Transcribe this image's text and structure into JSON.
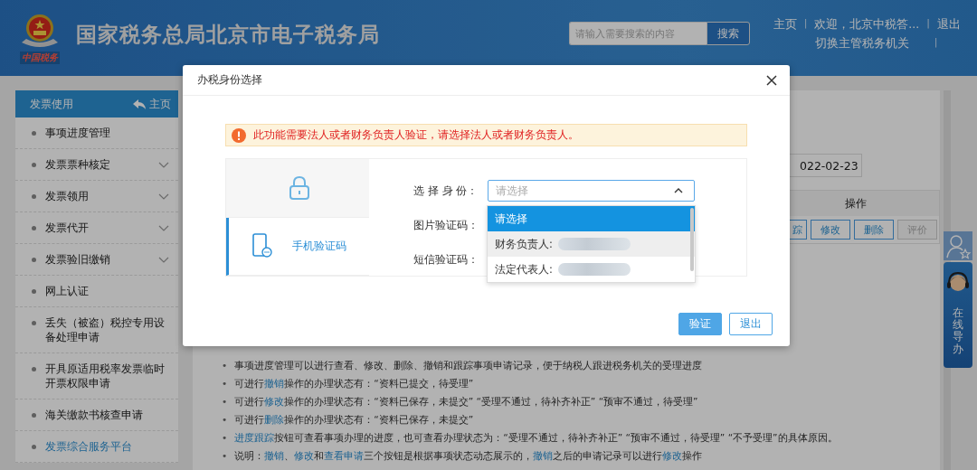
{
  "header": {
    "emblem_caption": "中国税务",
    "title": "国家税务总局北京市电子税务局",
    "search": {
      "placeholder": "请输入需要搜索的内容"
    },
    "search_button": "搜索",
    "nav_line1": [
      {
        "kind": "link",
        "text": "主页"
      },
      {
        "kind": "sep",
        "text": "|"
      },
      {
        "kind": "link",
        "text": "欢迎，北京中税答..."
      },
      {
        "kind": "sep",
        "text": "|"
      },
      {
        "kind": "link",
        "text": "退出"
      }
    ],
    "nav_line2": [
      {
        "kind": "link",
        "text": "切换主管税务机关"
      },
      {
        "kind": "sep",
        "text": "|"
      }
    ]
  },
  "sidebar": {
    "title": "发票使用",
    "home_link": "主页",
    "items": [
      {
        "label": "事项进度管理",
        "expandable": false,
        "selected": false
      },
      {
        "label": "发票票种核定",
        "expandable": true,
        "selected": false
      },
      {
        "label": "发票领用",
        "expandable": true,
        "selected": false
      },
      {
        "label": "发票代开",
        "expandable": true,
        "selected": false
      },
      {
        "label": "发票验旧缴销",
        "expandable": true,
        "selected": false
      },
      {
        "label": "网上认证",
        "expandable": false,
        "selected": false
      },
      {
        "label": "丢失（被盗）税控专用设备处理申请",
        "expandable": false,
        "selected": false
      },
      {
        "label": "开具原适用税率发票临时开票权限申请",
        "expandable": false,
        "selected": false
      },
      {
        "label": "海关缴款书核查申请",
        "expandable": false,
        "selected": false
      },
      {
        "label": "发票综合服务平台",
        "expandable": false,
        "selected": true
      }
    ]
  },
  "main": {
    "date_value": "022-02-23",
    "table": {
      "column": "操作",
      "row_buttons": [
        {
          "label": "踪",
          "disabled": false
        },
        {
          "label": "修改",
          "disabled": false
        },
        {
          "label": "删除",
          "disabled": false
        },
        {
          "label": "评价",
          "disabled": true
        }
      ]
    },
    "notes": [
      {
        "bullet": "•",
        "segments": [
          {
            "text": "事项进度管理可以进行查看、修改、删除、撤销和跟踪事项申请记录，便于纳税人跟进税务机关的受理进度",
            "link": false
          }
        ]
      },
      {
        "bullet": "•",
        "segments": [
          {
            "text": "可进行",
            "link": false
          },
          {
            "text": "撤销",
            "link": true
          },
          {
            "text": "操作的办理状态有：“资料已提交，待受理”",
            "link": false
          }
        ]
      },
      {
        "bullet": "•",
        "segments": [
          {
            "text": "可进行",
            "link": false
          },
          {
            "text": "修改",
            "link": true
          },
          {
            "text": "操作的办理状态有：“资料已保存，未提交”  “受理不通过，待补齐补正”  “预审不通过，待受理”",
            "link": false
          }
        ]
      },
      {
        "bullet": "•",
        "segments": [
          {
            "text": "可进行",
            "link": false
          },
          {
            "text": "删除",
            "link": true
          },
          {
            "text": "操作的办理状态有：“资料已保存，未提交”",
            "link": false
          }
        ]
      },
      {
        "bullet": "•",
        "segments": [
          {
            "text": "进度跟踪",
            "link": true
          },
          {
            "text": "按钮可查看事项办理的进度，也可查看办理状态为：“受理不通过，待补齐补正”  “预审不通过，待受理”  “不予受理”的具体原因。",
            "link": false
          }
        ]
      },
      {
        "bullet": "•",
        "segments": [
          {
            "text": "说明：",
            "link": false
          },
          {
            "text": "撤销",
            "link": true
          },
          {
            "text": "、",
            "link": false
          },
          {
            "text": "修改",
            "link": true
          },
          {
            "text": "和",
            "link": false
          },
          {
            "text": "查看申请",
            "link": true
          },
          {
            "text": "三个按钮是根据事项状态动态展示的，",
            "link": false
          },
          {
            "text": "撤销",
            "link": true
          },
          {
            "text": "之后的申请记录可以进行",
            "link": false
          },
          {
            "text": "修改",
            "link": true
          },
          {
            "text": "操作",
            "link": false
          }
        ]
      }
    ]
  },
  "side_widget": {
    "label": "在线导办"
  },
  "modal": {
    "title": "办税身份选择",
    "alert": "此功能需要法人或者财务负责人验证，请选择法人或者财务负责人。",
    "tabs": [
      {
        "kind": "lock",
        "selected": false
      },
      {
        "kind": "phone",
        "label": "手机验证码",
        "selected": true
      }
    ],
    "fields": [
      {
        "label": "选 择 身 份："
      },
      {
        "label": "图片验证码："
      },
      {
        "label": "短信验证码："
      }
    ],
    "select": {
      "placeholder": "请选择",
      "expanded": true,
      "options": [
        {
          "label": "请选择",
          "selected": true,
          "hovered": false,
          "redacted": false
        },
        {
          "label": "财务负责人:",
          "selected": false,
          "hovered": true,
          "redacted": true
        },
        {
          "label": "法定代表人:",
          "selected": false,
          "hovered": false,
          "redacted": true
        }
      ]
    },
    "buttons": [
      {
        "kind": "primary",
        "label": "验证"
      },
      {
        "kind": "secondary",
        "label": "退出"
      }
    ]
  }
}
